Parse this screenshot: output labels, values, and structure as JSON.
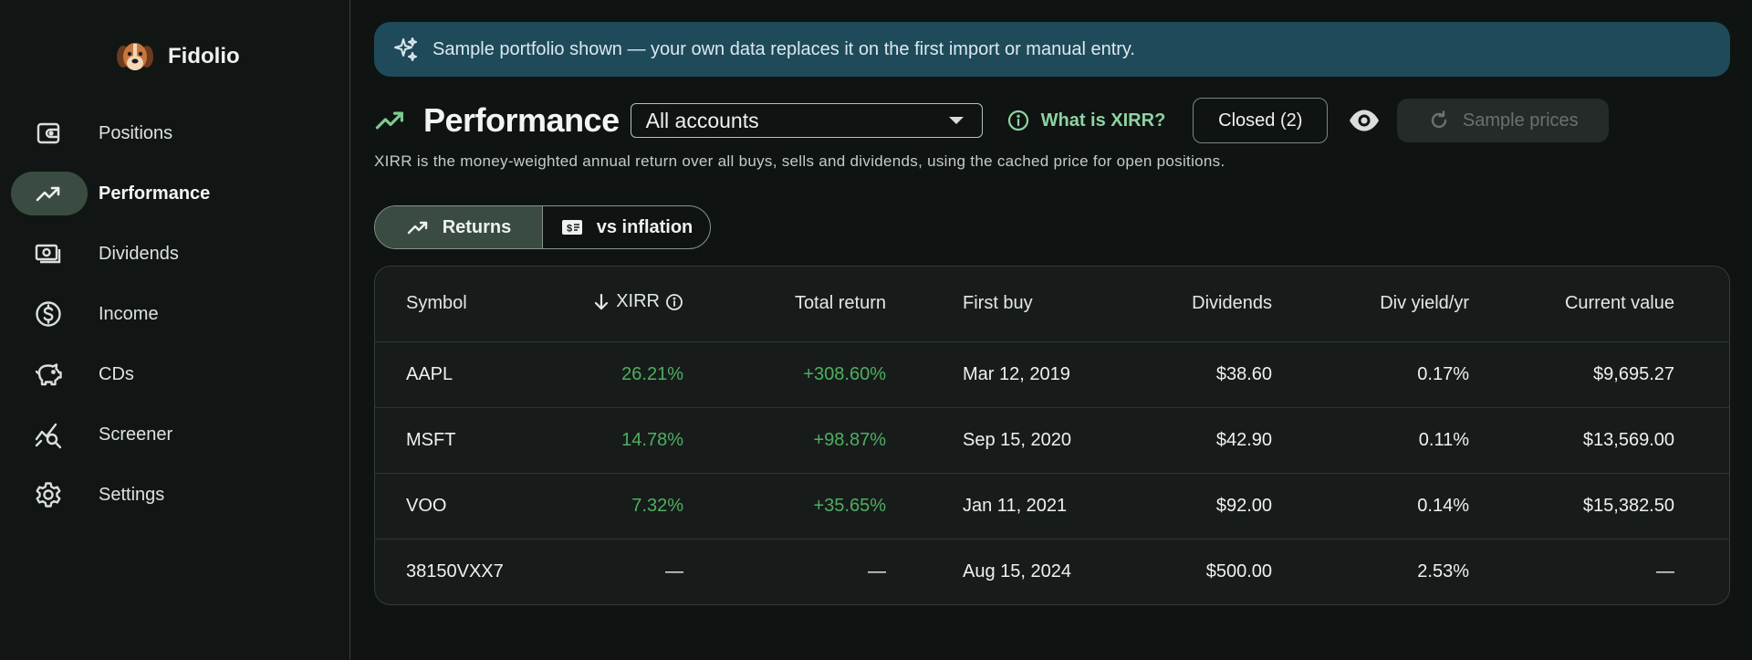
{
  "app": {
    "name": "Fidolio"
  },
  "sidebar": {
    "items": [
      {
        "label": "Positions",
        "icon": "wallet-icon"
      },
      {
        "label": "Performance",
        "icon": "trending-up-icon",
        "active": true
      },
      {
        "label": "Dividends",
        "icon": "cash-icon"
      },
      {
        "label": "Income",
        "icon": "dollar-circle-icon"
      },
      {
        "label": "CDs",
        "icon": "piggy-bank-icon"
      },
      {
        "label": "Screener",
        "icon": "screener-icon"
      },
      {
        "label": "Settings",
        "icon": "gear-icon"
      }
    ]
  },
  "banner": {
    "text": "Sample portfolio shown — your own data replaces it on the first import or manual entry.",
    "icon": "sparkles-icon"
  },
  "header": {
    "title": "Performance",
    "account_select": {
      "value": "All accounts"
    },
    "xirr_link": "What is XIRR?",
    "closed_button": "Closed (2)",
    "sample_prices_button": "Sample prices",
    "subtitle": "XIRR is the money-weighted annual return over all buys, sells and dividends, using the cached price for open positions."
  },
  "tabs": {
    "returns": "Returns",
    "inflation": "vs inflation"
  },
  "table": {
    "headers": {
      "symbol": "Symbol",
      "xirr": "XIRR",
      "total": "Total return",
      "first": "First buy",
      "dividends": "Dividends",
      "yield": "Div yield/yr",
      "current": "Current value"
    },
    "rows": [
      {
        "symbol": "AAPL",
        "xirr": "26.21%",
        "total": "+308.60%",
        "first": "Mar 12, 2019",
        "dividends": "$38.60",
        "yield": "0.17%",
        "current": "$9,695.27"
      },
      {
        "symbol": "MSFT",
        "xirr": "14.78%",
        "total": "+98.87%",
        "first": "Sep 15, 2020",
        "dividends": "$42.90",
        "yield": "0.11%",
        "current": "$13,569.00"
      },
      {
        "symbol": "VOO",
        "xirr": "7.32%",
        "total": "+35.65%",
        "first": "Jan 11, 2021",
        "dividends": "$92.00",
        "yield": "0.14%",
        "current": "$15,382.50"
      },
      {
        "symbol": "38150VXX7",
        "xirr": "—",
        "total": "—",
        "first": "Aug 15, 2024",
        "dividends": "$500.00",
        "yield": "2.53%",
        "current": "—"
      }
    ]
  },
  "colors": {
    "accent": "#3a4c41",
    "positive": "#4fae62",
    "banner": "#1f4a5a",
    "link": "#8fd3a2"
  }
}
